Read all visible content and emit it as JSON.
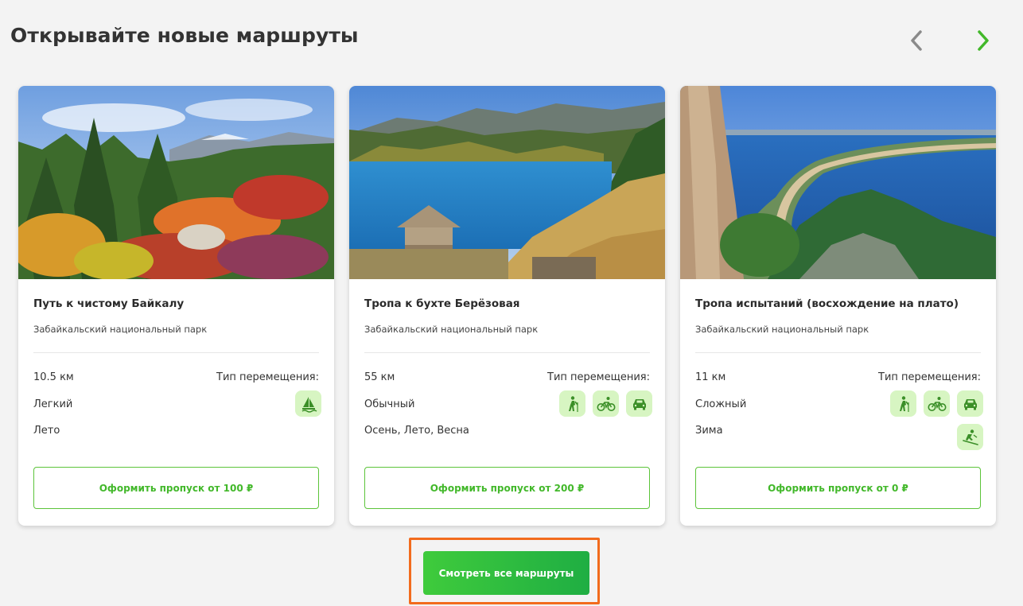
{
  "section": {
    "title": "Открывайте новые маршруты"
  },
  "nav": {
    "prev_icon": "chevron-left-icon",
    "next_icon": "chevron-right-icon",
    "prev_color": "#8a8a8a",
    "next_color": "#42b82a"
  },
  "cards": [
    {
      "title": "Путь к чистому Байкалу",
      "park": "Забайкальский национальный парк",
      "distance": "10.5 км",
      "difficulty": "Легкий",
      "season": "Лето",
      "movement_label": "Тип перемещения:",
      "movement_icons": [
        "sailboat-icon"
      ],
      "button_label": "Оформить пропуск от 100 ₽"
    },
    {
      "title": "Тропа к бухте Берёзовая",
      "park": "Забайкальский национальный парк",
      "distance": "55 км",
      "difficulty": "Обычный",
      "season": "Осень, Лето, Весна",
      "movement_label": "Тип перемещения:",
      "movement_icons": [
        "hiker-icon",
        "bicycle-icon",
        "car-icon"
      ],
      "button_label": "Оформить пропуск от 200 ₽"
    },
    {
      "title": "Тропа испытаний (восхождение на плато)",
      "park": "Забайкальский национальный парк",
      "distance": "11 км",
      "difficulty": "Сложный",
      "season": "Зима",
      "movement_label": "Тип перемещения:",
      "movement_icons": [
        "hiker-icon",
        "bicycle-icon",
        "car-icon",
        "skier-icon"
      ],
      "button_label": "Оформить пропуск от 0 ₽"
    }
  ],
  "all_routes_button": {
    "label": "Смотреть все маршруты"
  },
  "colors": {
    "accent_green": "#42b82a",
    "icon_bg": "#d7f5c2",
    "icon_fg": "#3b8f28",
    "highlight_orange": "#f26b1d"
  }
}
